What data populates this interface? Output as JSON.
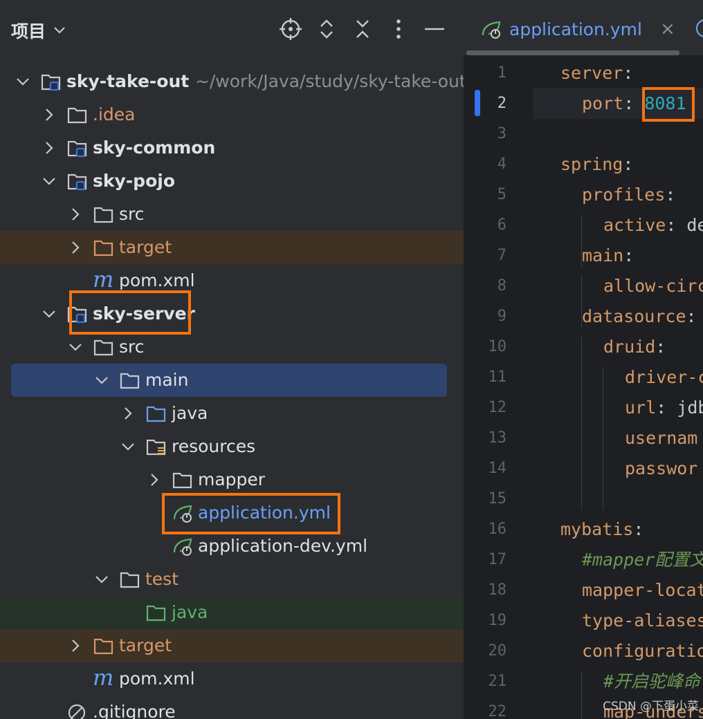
{
  "project_panel": {
    "title": "项目",
    "header_buttons": [
      "locate-icon",
      "expand-collapse-icon",
      "collapse-all-icon",
      "more-icon",
      "minimize-icon"
    ],
    "tree": [
      {
        "label": "sky-take-out",
        "hint": "~/work/Java/study/sky-take-out"
      },
      {
        "label": ".idea"
      },
      {
        "label": "sky-common"
      },
      {
        "label": "sky-pojo"
      },
      {
        "label": "src"
      },
      {
        "label": "target"
      },
      {
        "label": "pom.xml"
      },
      {
        "label": "sky-server"
      },
      {
        "label": "src"
      },
      {
        "label": "main"
      },
      {
        "label": "java"
      },
      {
        "label": "resources"
      },
      {
        "label": "mapper"
      },
      {
        "label": "application.yml"
      },
      {
        "label": "application-dev.yml"
      },
      {
        "label": "test"
      },
      {
        "label": "java"
      },
      {
        "label": "target"
      },
      {
        "label": "pom.xml"
      },
      {
        "label": ".gitignore"
      }
    ]
  },
  "editor": {
    "tab": {
      "title": "application.yml",
      "close": "×"
    },
    "current_line": 2,
    "line_numbers": [
      "1",
      "2",
      "3",
      "4",
      "5",
      "6",
      "7",
      "8",
      "9",
      "10",
      "11",
      "12",
      "13",
      "14",
      "15",
      "16",
      "17",
      "18",
      "19",
      "20",
      "21",
      "22"
    ],
    "code": [
      {
        "line": 1,
        "key": "server",
        "sep": ":",
        "val": ""
      },
      {
        "line": 2,
        "key": "port",
        "sep": ": ",
        "val": "8081"
      },
      {
        "line": 3,
        "key": "",
        "sep": "",
        "val": ""
      },
      {
        "line": 4,
        "key": "spring",
        "sep": ":",
        "val": ""
      },
      {
        "line": 5,
        "key": "profiles",
        "sep": ":",
        "val": ""
      },
      {
        "line": 6,
        "key": "active",
        "sep": ": ",
        "val": "de"
      },
      {
        "line": 7,
        "key": "main",
        "sep": ":",
        "val": ""
      },
      {
        "line": 8,
        "key": "allow-circ",
        "sep": "",
        "val": ""
      },
      {
        "line": 9,
        "key": "datasource",
        "sep": ":",
        "val": ""
      },
      {
        "line": 10,
        "key": "druid",
        "sep": ":",
        "val": ""
      },
      {
        "line": 11,
        "key": "driver-c",
        "sep": "",
        "val": ""
      },
      {
        "line": 12,
        "key": "url",
        "sep": ": ",
        "val": "jdb"
      },
      {
        "line": 13,
        "key": "usernam",
        "sep": "",
        "val": ""
      },
      {
        "line": 14,
        "key": "passwor",
        "sep": "",
        "val": ""
      },
      {
        "line": 15,
        "key": "",
        "sep": "",
        "val": ""
      },
      {
        "line": 16,
        "key": "mybatis",
        "sep": ":",
        "val": ""
      },
      {
        "line": 17,
        "comment": "#mapper配置文"
      },
      {
        "line": 18,
        "key": "mapper-locat",
        "sep": "",
        "val": ""
      },
      {
        "line": 19,
        "key": "type-aliases",
        "sep": "",
        "val": ""
      },
      {
        "line": 20,
        "key": "configuratio",
        "sep": "",
        "val": ""
      },
      {
        "line": 21,
        "comment": "#开启驼峰命"
      },
      {
        "line": 22,
        "key": "map-unders",
        "sep": "",
        "val": ""
      }
    ]
  },
  "colors": {
    "highlight_box": "#f5730f",
    "selected_row": "#2e436e",
    "excluded_row": "#3d3223",
    "test_row": "#26332a",
    "yaml_key": "#d49a6a",
    "number": "#2aacb8"
  },
  "watermark": "CSDN @下蛋小菜"
}
